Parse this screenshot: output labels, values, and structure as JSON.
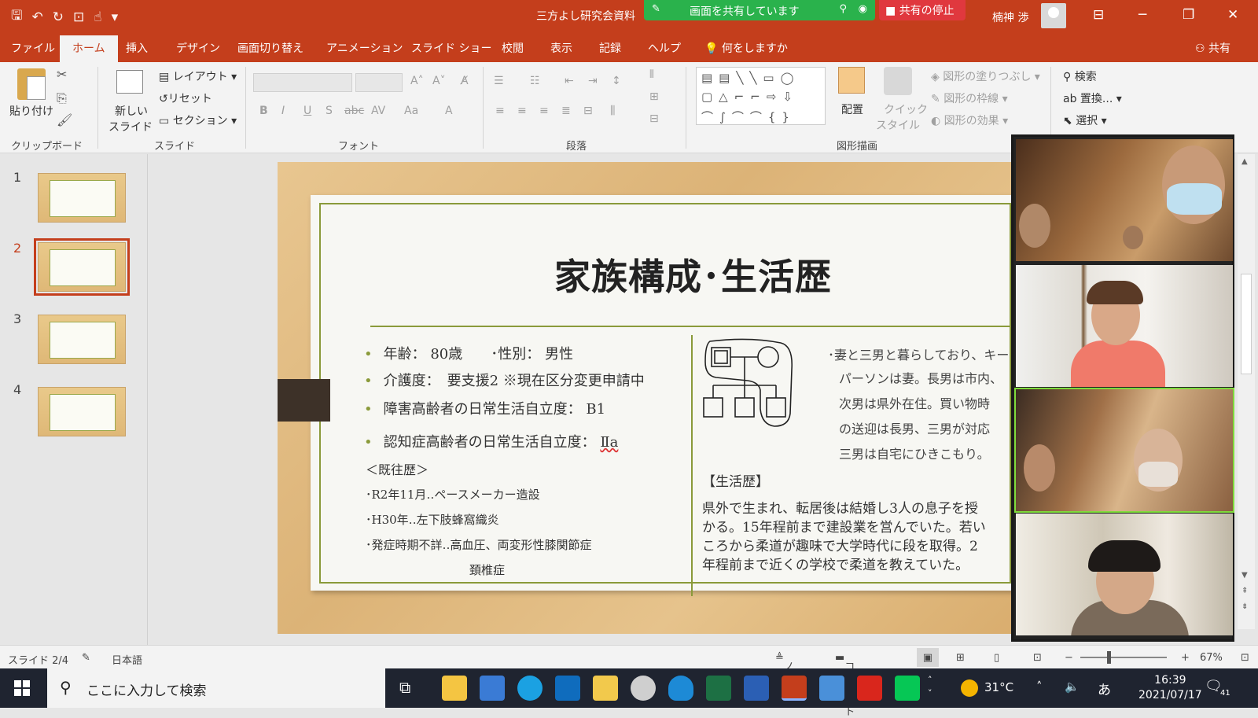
{
  "titlebar": {
    "doc_title": "三方よし研究会資料",
    "share_status": "画面を共有しています",
    "stop_share": "共有の停止",
    "user": "楠神 渉",
    "bg_color": "#c43e1c"
  },
  "tabs": [
    "ファイル",
    "ホーム",
    "挿入",
    "デザイン",
    "画面切り替え",
    "アニメーション",
    "スライド ショー",
    "校閲",
    "表示",
    "記録",
    "ヘルプ"
  ],
  "active_tab": "ホーム",
  "tell_me": "何をしますか",
  "share_button": "共有",
  "ribbon": {
    "paste": "貼り付け",
    "new_slide_1": "新しい",
    "new_slide_2": "スライド",
    "layout": "レイアウト",
    "reset": "リセット",
    "section": "セクション",
    "arrange": "配置",
    "quick_style_1": "クイック",
    "quick_style_2": "スタイル",
    "fill": "図形の塗りつぶし",
    "outline": "図形の枠線",
    "effect": "図形の効果",
    "find": "検索",
    "replace": "置換...",
    "select": "選択",
    "groups": {
      "clipboard": "クリップボード",
      "slides": "スライド",
      "font": "フォント",
      "paragraph": "段落",
      "drawing": "図形描画"
    }
  },
  "thumbnails": [
    "1",
    "2",
    "3",
    "4"
  ],
  "selected_slide": "2",
  "slide": {
    "title": "家族構成･生活歴",
    "left": {
      "b1": "年齢： 80歳　　･性別： 男性",
      "b2": "介護度：　要支援2 ※現在区分変更申請中",
      "b3": "障害高齢者の日常生活自立度： B1",
      "b4": "認知症高齢者の日常生活自立度：",
      "b4_val": "Ⅱa",
      "history_heading": "＜既往歴＞",
      "h1": "･R2年11月‥ペースメーカー造設",
      "h2": "･H30年‥左下肢蜂窩織炎",
      "h3": "･発症時期不詳‥高血圧、両変形性膝関節症",
      "h4": "頚椎症"
    },
    "right": {
      "family_1": "･妻と三男と暮らしており、キー",
      "family_2": "パーソンは妻。長男は市内、",
      "family_3": "次男は県外在住。買い物時",
      "family_4": "の送迎は長男、三男が対応",
      "family_5": "三男は自宅にひきこもり。",
      "life_heading": "【生活歴】",
      "life_1": "県外で生まれ、転居後は結婚し3人の息子を授",
      "life_2": "かる。15年程前まで建設業を営んでいた。若い",
      "life_3": "ころから柔道が趣味で大学時代に段を取得。2",
      "life_4": "年程前まで近くの学校で柔道を教えていた。"
    }
  },
  "status": {
    "slide_count": "スライド 2/4",
    "language": "日本語",
    "notes": "ノート",
    "comments": "コメント",
    "zoom": "67%"
  },
  "taskbar": {
    "search_placeholder": "ここに入力して検索",
    "temperature": "31°C",
    "ime": "あ",
    "time": "16:39",
    "date": "2021/07/17",
    "notifications": "41"
  }
}
